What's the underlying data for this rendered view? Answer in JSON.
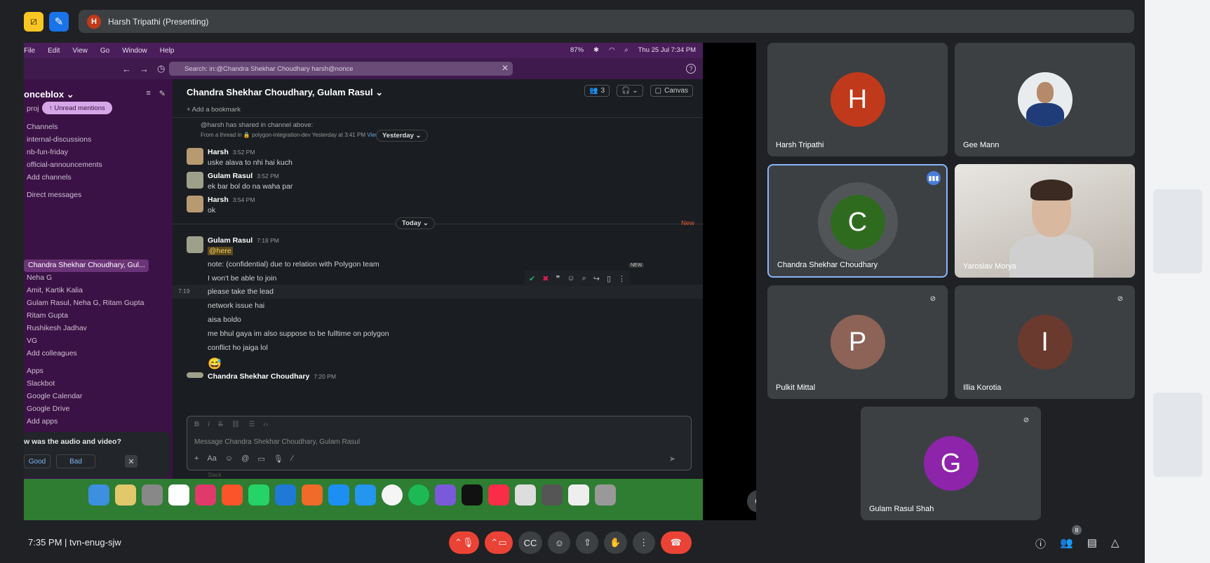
{
  "top": {
    "presenter_initial": "H",
    "presenter_label": "Harsh Tripathi (Presenting)"
  },
  "mac": {
    "menus": [
      "File",
      "Edit",
      "View",
      "Go",
      "Window",
      "Help"
    ],
    "battery": "87%",
    "clock": "Thu 25 Jul 7:34 PM"
  },
  "slack": {
    "search": "Search: in:@Chandra Shekhar Choudhary harsh@nonce",
    "workspace": "oncebloх",
    "unread": "↑ Unread mentions",
    "proj": "proj",
    "channels_head": "Channels",
    "channels": [
      "internal-discussions",
      "nb-fun-friday",
      "official-announcements",
      "Add channels"
    ],
    "dm_head": "Direct messages",
    "dms": [
      "Chandra Shekhar Choudhary, Gul...",
      "Neha G",
      "Amit, Kartik Kalia",
      "Gulam Rasul, Neha G, Ritam Gupta",
      "Ritam Gupta",
      "Rushikesh Jadhav",
      "VG",
      "Add colleagues"
    ],
    "apps_head": "Apps",
    "apps": [
      "Slackbot",
      "Google Calendar",
      "Google Drive",
      "Add apps"
    ],
    "feedback_q": "w was the audio and video?",
    "good": "Good",
    "bad": "Bad",
    "channel_title": "Chandra Shekhar Choudhary, Gulam Rasul ⌄",
    "member_count": "3",
    "canvas": "Canvas",
    "bookmark": "+ Add a bookmark",
    "thread_note": "@harsh has shared in channel above:",
    "thread_from": "From a thread in 🔒 polygon-integration-dev  Yesterday at 3:41 PM",
    "view_reply": "View reply",
    "yesterday": "Yesterday ⌄",
    "today": "Today ⌄",
    "new": "New",
    "messages": [
      {
        "name": "Harsh",
        "time": "3:52 PM",
        "text": "uske alava to nhi hai kuch"
      },
      {
        "name": "Gulam Rasul",
        "time": "3:52 PM",
        "text": "ek bar bol do na waha par"
      },
      {
        "name": "Harsh",
        "time": "3:54 PM",
        "text": "ok"
      }
    ],
    "today_msg": {
      "name": "Gulam Rasul",
      "time": "7:18 PM",
      "mention": "@here"
    },
    "lines": [
      "note: (confidential) due to relation with Polygon team",
      "I won't be able to join",
      "please take the lead",
      "network issue hai",
      "aisa boldo",
      "me bhul gaya im also suppose to be fulltime on polygon",
      "conflict ho jaiga lol",
      "😅"
    ],
    "hover_time": "7:19",
    "last_msg": {
      "name": "Chandra Shekhar Choudhary",
      "time": "7:20 PM"
    },
    "new_badge": "NEW",
    "composer_placeholder": "Message Chandra Shekhar Choudhary, Gulam Rasul",
    "slack_label": "Slack"
  },
  "tiles": [
    {
      "name": "Harsh Tripathi",
      "initial": "H",
      "color": "#c0391b"
    },
    {
      "name": "Gee Mann"
    },
    {
      "name": "Chandra Shekhar Choudhary",
      "initial": "C",
      "color": "#2e6b1f"
    },
    {
      "name": "Yaroslav Morya"
    },
    {
      "name": "Pulkit Mittal",
      "initial": "P",
      "color": "#8d6357"
    },
    {
      "name": "Illia Korotia",
      "initial": "I",
      "color": "#6b3a2e"
    },
    {
      "name": "Gulam Rasul Shah",
      "initial": "G",
      "color": "#8e24aa"
    }
  ],
  "bottom": {
    "time": "7:35 PM",
    "meeting_code": "tvn-enug-sjw",
    "people_count": "8"
  }
}
